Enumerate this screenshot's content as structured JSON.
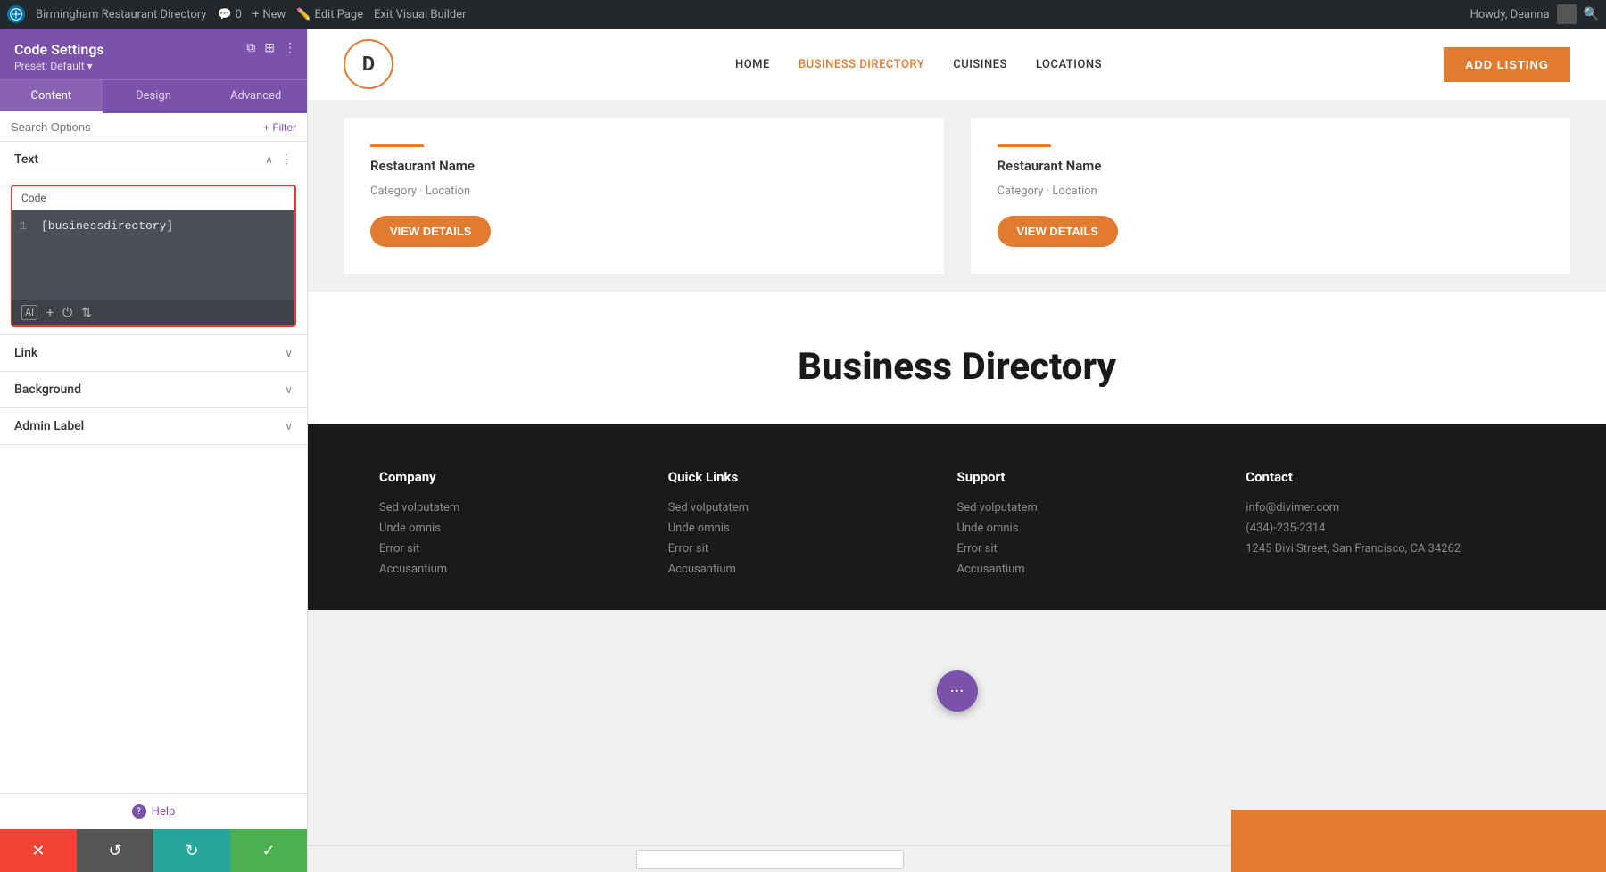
{
  "adminBar": {
    "wpLabel": "WP",
    "siteName": "Birmingham Restaurant Directory",
    "comments": "0",
    "newLabel": "New",
    "editPage": "Edit Page",
    "exitBuilder": "Exit Visual Builder",
    "howdy": "Howdy, Deanna"
  },
  "sidebar": {
    "title": "Code Settings",
    "preset": "Preset: Default ▾",
    "tabs": [
      "Content",
      "Design",
      "Advanced"
    ],
    "activeTab": "Content",
    "searchPlaceholder": "Search Options",
    "filterLabel": "+ Filter",
    "sections": {
      "text": {
        "label": "Text",
        "codeLabel": "Code",
        "codeLine": "[businessdirectory]",
        "lineNum": "1"
      },
      "link": {
        "label": "Link"
      },
      "background": {
        "label": "Background"
      },
      "adminLabel": {
        "label": "Admin Label"
      }
    },
    "helpLabel": "Help"
  },
  "actionBar": {
    "cancel": "✕",
    "undo": "↺",
    "redo": "↻",
    "save": "✓"
  },
  "website": {
    "nav": {
      "logoLetter": "D",
      "links": [
        "HOME",
        "BUSINESS DIRECTORY",
        "CUISINES",
        "LOCATIONS"
      ],
      "activeLink": "BUSINESS DIRECTORY",
      "addListing": "ADD LISTING"
    },
    "cards": [
      {
        "title": "Restaurant Name",
        "subtitle": "Category · Location",
        "btnLabel": "VIEW DETAILS"
      },
      {
        "title": "Restaurant Name",
        "subtitle": "Category · Location",
        "btnLabel": "VIEW DETAILS"
      }
    ],
    "bizDirTitle": "Business Directory",
    "footer": {
      "columns": [
        {
          "title": "Company",
          "links": [
            "Sed volputatem",
            "Unde omnis",
            "Error sit",
            "Accusantium"
          ]
        },
        {
          "title": "Quick Links",
          "links": [
            "Sed volputatem",
            "Unde omnis",
            "Error sit",
            "Accusantium"
          ]
        },
        {
          "title": "Support",
          "links": [
            "Sed volputatem",
            "Unde omnis",
            "Error sit",
            "Accusantium"
          ]
        },
        {
          "title": "Contact",
          "links": [
            "info@divimer.com",
            "(434)-235-2314",
            "1245 Divi Street, San Francisco, CA 34262"
          ]
        }
      ]
    },
    "fabIcon": "•••"
  },
  "icons": {
    "aiIcon": "AI",
    "plusIcon": "+",
    "powerIcon": "⏻",
    "sortIcon": "⇅",
    "chevronDown": "∨",
    "chevronUp": "∧",
    "threeDot": "⋮",
    "helpCircle": "?",
    "searchIcon": "🔍",
    "filterPlus": "+ Filter"
  }
}
